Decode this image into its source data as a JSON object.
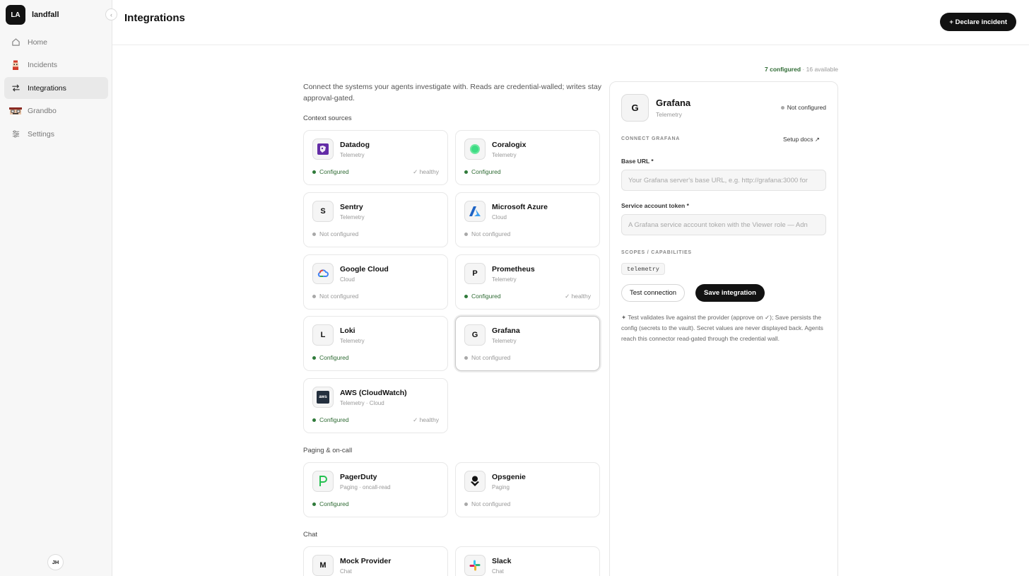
{
  "sidebar": {
    "org_initials": "LA",
    "org_name": "landfall",
    "collapse_icon": "chevron-left-icon",
    "items": [
      {
        "label": "Home",
        "icon": "home-icon"
      },
      {
        "label": "Incidents",
        "icon": "incidents-mascot-icon"
      },
      {
        "label": "Integrations",
        "icon": "swap-arrows-icon",
        "active": true
      },
      {
        "label": "Grandbo",
        "icon": "grandbo-mascot-icon"
      },
      {
        "label": "Settings",
        "icon": "sliders-icon"
      }
    ],
    "user_initials": "JH"
  },
  "header": {
    "title": "Integrations",
    "declare_button": "+ Declare incident"
  },
  "summary": {
    "configured": "7 configured",
    "separator": "·",
    "available": "16 available"
  },
  "intro": "Connect the systems your agents investigate with. Reads are credential-walled; writes stay approval-gated.",
  "sections": {
    "context": "Context sources",
    "paging": "Paging & on-call",
    "chat": "Chat"
  },
  "cards": {
    "datadog": {
      "name": "Datadog",
      "category": "Telemetry",
      "status": "Configured",
      "health": "✓ healthy"
    },
    "coralogix": {
      "name": "Coralogix",
      "category": "Telemetry",
      "status": "Configured"
    },
    "sentry": {
      "name": "Sentry",
      "category": "Telemetry",
      "status": "Not configured",
      "initial": "S"
    },
    "azure": {
      "name": "Microsoft Azure",
      "category": "Cloud",
      "status": "Not configured"
    },
    "gcloud": {
      "name": "Google Cloud",
      "category": "Cloud",
      "status": "Not configured"
    },
    "prometheus": {
      "name": "Prometheus",
      "category": "Telemetry",
      "status": "Configured",
      "health": "✓ healthy",
      "initial": "P"
    },
    "loki": {
      "name": "Loki",
      "category": "Telemetry",
      "status": "Configured",
      "initial": "L"
    },
    "grafana": {
      "name": "Grafana",
      "category": "Telemetry",
      "status": "Not configured",
      "initial": "G"
    },
    "aws": {
      "name": "AWS (CloudWatch)",
      "category": "Telemetry · Cloud",
      "status": "Configured",
      "health": "✓ healthy",
      "icon_text": "aws"
    },
    "pagerduty": {
      "name": "PagerDuty",
      "category": "Paging · oncall-read",
      "status": "Configured"
    },
    "opsgenie": {
      "name": "Opsgenie",
      "category": "Paging",
      "status": "Not configured"
    },
    "mock": {
      "name": "Mock Provider",
      "category": "Chat",
      "initial": "M"
    },
    "slack": {
      "name": "Slack",
      "category": "Chat"
    }
  },
  "panel": {
    "initial": "G",
    "name": "Grafana",
    "category": "Telemetry",
    "status": "Not configured",
    "section": "CONNECT GRAFANA",
    "docs": "Setup docs ↗",
    "base_url_label": "Base URL *",
    "base_url_placeholder": "Your Grafana server's base URL, e.g. http://grafana:3000 for",
    "token_label": "Service account token *",
    "token_placeholder": "A Grafana service account token with the Viewer role — Adn",
    "scopes_label": "SCOPES / CAPABILITIES",
    "scope": "telemetry",
    "test_button": "Test connection",
    "save_button": "Save integration",
    "note": "✦ Test validates live against the provider (approve on ✓); Save persists the config (secrets to the vault). Secret values are never displayed back. Agents reach this connector read-gated through the credential wall."
  },
  "colors": {
    "configured": "#2f6b34",
    "not_configured_dot": "#a8a8a8",
    "primary_button": "#121212"
  }
}
